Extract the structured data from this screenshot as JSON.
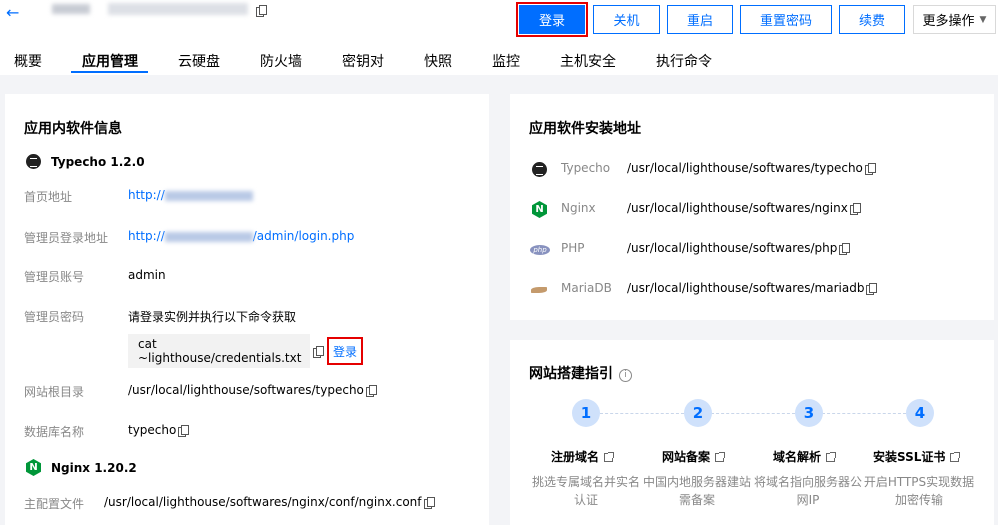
{
  "header": {
    "back_icon": "arrow-left-icon",
    "buttons": {
      "login": "登录",
      "shutdown": "关机",
      "restart": "重启",
      "reset_password": "重置密码",
      "renew": "续费",
      "more": "更多操作"
    }
  },
  "tabs": [
    "概要",
    "应用管理",
    "云硬盘",
    "防火墙",
    "密钥对",
    "快照",
    "监控",
    "主机安全",
    "执行命令"
  ],
  "app_info": {
    "title": "应用内软件信息",
    "typecho": {
      "name": "Typecho 1.2.0",
      "rows": {
        "home_label": "首页地址",
        "home_value_prefix": "http://",
        "admin_login_label": "管理员登录地址",
        "admin_login_prefix": "http://",
        "admin_login_suffix": "/admin/login.php",
        "admin_account_label": "管理员账号",
        "admin_account_value": "admin",
        "admin_password_label": "管理员密码",
        "admin_password_hint": "请登录实例并执行以下命令获取",
        "command": "cat ~lighthouse/credentials.txt",
        "login_link": "登录",
        "web_root_label": "网站根目录",
        "web_root_value": "/usr/local/lighthouse/softwares/typecho",
        "db_name_label": "数据库名称",
        "db_name_value": "typecho"
      }
    },
    "nginx": {
      "name": "Nginx 1.20.2",
      "config_label": "主配置文件",
      "config_value": "/usr/local/lighthouse/softwares/nginx/conf/nginx.conf"
    }
  },
  "install_paths": {
    "title": "应用软件安装地址",
    "items": [
      {
        "name": "Typecho",
        "path": "/usr/local/lighthouse/softwares/typecho"
      },
      {
        "name": "Nginx",
        "path": "/usr/local/lighthouse/softwares/nginx"
      },
      {
        "name": "PHP",
        "path": "/usr/local/lighthouse/softwares/php"
      },
      {
        "name": "MariaDB",
        "path": "/usr/local/lighthouse/softwares/mariadb"
      }
    ]
  },
  "guide": {
    "title": "网站搭建指引",
    "steps": [
      {
        "num": "1",
        "title": "注册域名",
        "desc": "挑选专属域名并实名认证"
      },
      {
        "num": "2",
        "title": "网站备案",
        "desc": "中国内地服务器建站需备案"
      },
      {
        "num": "3",
        "title": "域名解析",
        "desc": "将域名指向服务器公网IP"
      },
      {
        "num": "4",
        "title": "安装SSL证书",
        "desc": "开启HTTPS实现数据加密传输"
      }
    ]
  },
  "colors": {
    "accent": "#006eff",
    "highlight": "#e50000",
    "bg": "#f3f4f7"
  }
}
